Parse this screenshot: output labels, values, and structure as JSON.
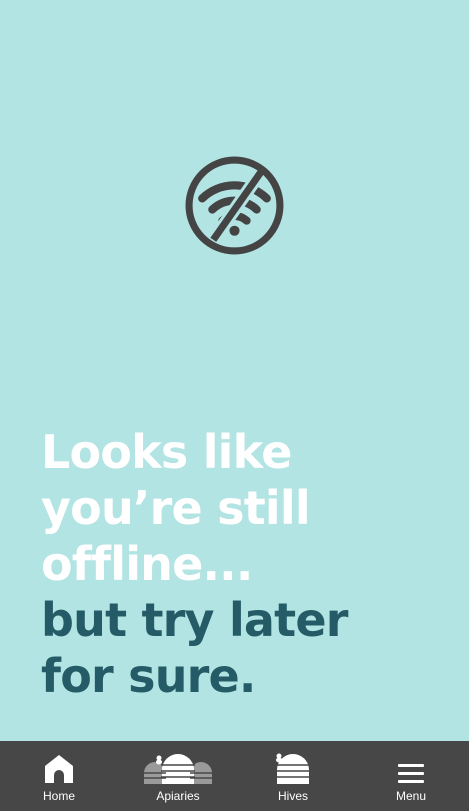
{
  "status": {
    "icon": "wifi-off-icon",
    "message_primary": [
      "Looks like",
      "you’re still",
      "offline..."
    ],
    "message_secondary": [
      "but try later",
      "for sure."
    ]
  },
  "tabbar": {
    "tabs": [
      {
        "label": "Home",
        "icon": "home-icon"
      },
      {
        "label": "Apiaries",
        "icon": "apiaries-icon"
      },
      {
        "label": "Hives",
        "icon": "hive-icon"
      },
      {
        "label": "Menu",
        "icon": "hamburger-menu-icon"
      }
    ]
  },
  "colors": {
    "background": "#b2e4e3",
    "primary_text": "#ffffff",
    "secondary_text": "#245b66",
    "icon": "#444444",
    "tabbar": "#474747"
  }
}
